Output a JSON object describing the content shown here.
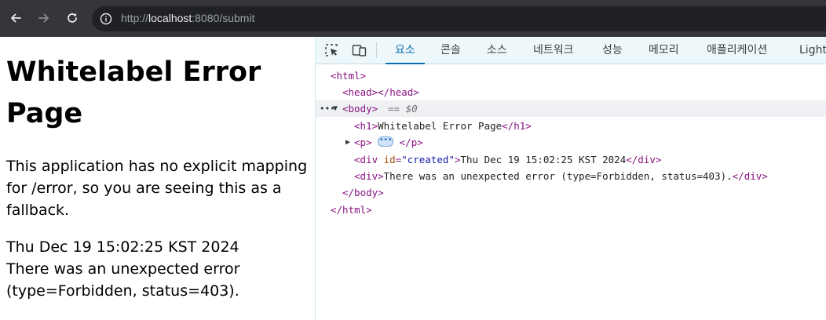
{
  "browser": {
    "url_scheme": "http://",
    "url_host": "localhost",
    "url_rest": ":8080/submit",
    "icons": [
      "back-arrow-icon",
      "forward-arrow-icon",
      "reload-icon",
      "info-icon"
    ]
  },
  "page": {
    "heading": "Whitelabel Error Page",
    "paragraph": "This application has no explicit mapping for /error, so you are seeing this as a fallback.",
    "created": "Thu Dec 19 15:02:25 KST 2024",
    "error_message": "There was an unexpected error (type=Forbidden, status=403)."
  },
  "devtools": {
    "tabs": [
      "요소",
      "콘솔",
      "소스",
      "네트워크",
      "성능",
      "메모리",
      "애플리케이션",
      "Light"
    ],
    "active_tab": "요소",
    "dom": {
      "html_open": "<html>",
      "head": "<head></head>",
      "body_open": "<body>",
      "selected_marker": "== $0",
      "h1_open": "<h1>",
      "h1_text": "Whitelabel Error Page",
      "h1_close": "</h1>",
      "p_open": "<p>",
      "p_close": "</p>",
      "div_tag_open": "<div",
      "div_attr_name": "id",
      "div_attr_eq": "=",
      "div_attr_value": "\"created\"",
      "div_tag_close_bracket": ">",
      "div1_text": "Thu Dec 19 15:02:25 KST 2024",
      "div_close": "</div>",
      "div2_open": "<div>",
      "div2_text": "There was an unexpected error (type=Forbidden, status=403).",
      "body_close": "</body>",
      "html_close": "</html>"
    }
  }
}
